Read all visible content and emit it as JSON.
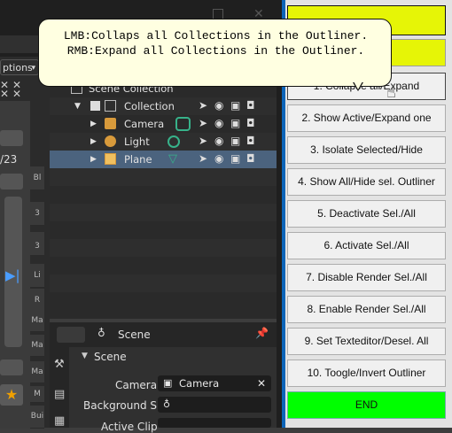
{
  "tooltip": {
    "line1": "LMB:Collaps all Collections in the Outliner.",
    "line2": "RMB:Expand all Collections in the Outliner."
  },
  "left": {
    "options_label": "ptions",
    "frame_text": "/23",
    "vertical_tabs": [
      "Bl",
      "3",
      "3",
      "3",
      "Li",
      "R",
      "Ma",
      "Ma",
      "Ma",
      "M",
      "Bui"
    ]
  },
  "outliner": {
    "scene_collection": "Scene Collection",
    "items": [
      {
        "label": "Collection",
        "indent": 1
      },
      {
        "label": "Camera",
        "indent": 2
      },
      {
        "label": "Light",
        "indent": 2
      },
      {
        "label": "Plane",
        "indent": 2,
        "selected": true
      }
    ]
  },
  "properties": {
    "header": "Scene",
    "section": "Scene",
    "camera_label": "Camera",
    "camera_value": "Camera",
    "bg_label": "Background S...",
    "active_clip_label": "Active Clip"
  },
  "panel": {
    "buttons": [
      "1. Collapse all/Expand",
      "2. Show Active/Expand one Level",
      "3. Isolate Selected/Hide",
      "4. Show All/Hide sel. Outliner",
      "5. Deactivate Sel./All",
      "6. Activate Sel./All",
      "7. Disable Render Sel./All",
      "8. Enable Render Sel./All",
      "9. Set Texteditor/Desel. All",
      "10. Toogle/Invert Outliner"
    ],
    "end_label": "END",
    "colors": {
      "yellow": "#e6f506",
      "green": "#00ff00",
      "accent": "#0c64b8"
    }
  }
}
